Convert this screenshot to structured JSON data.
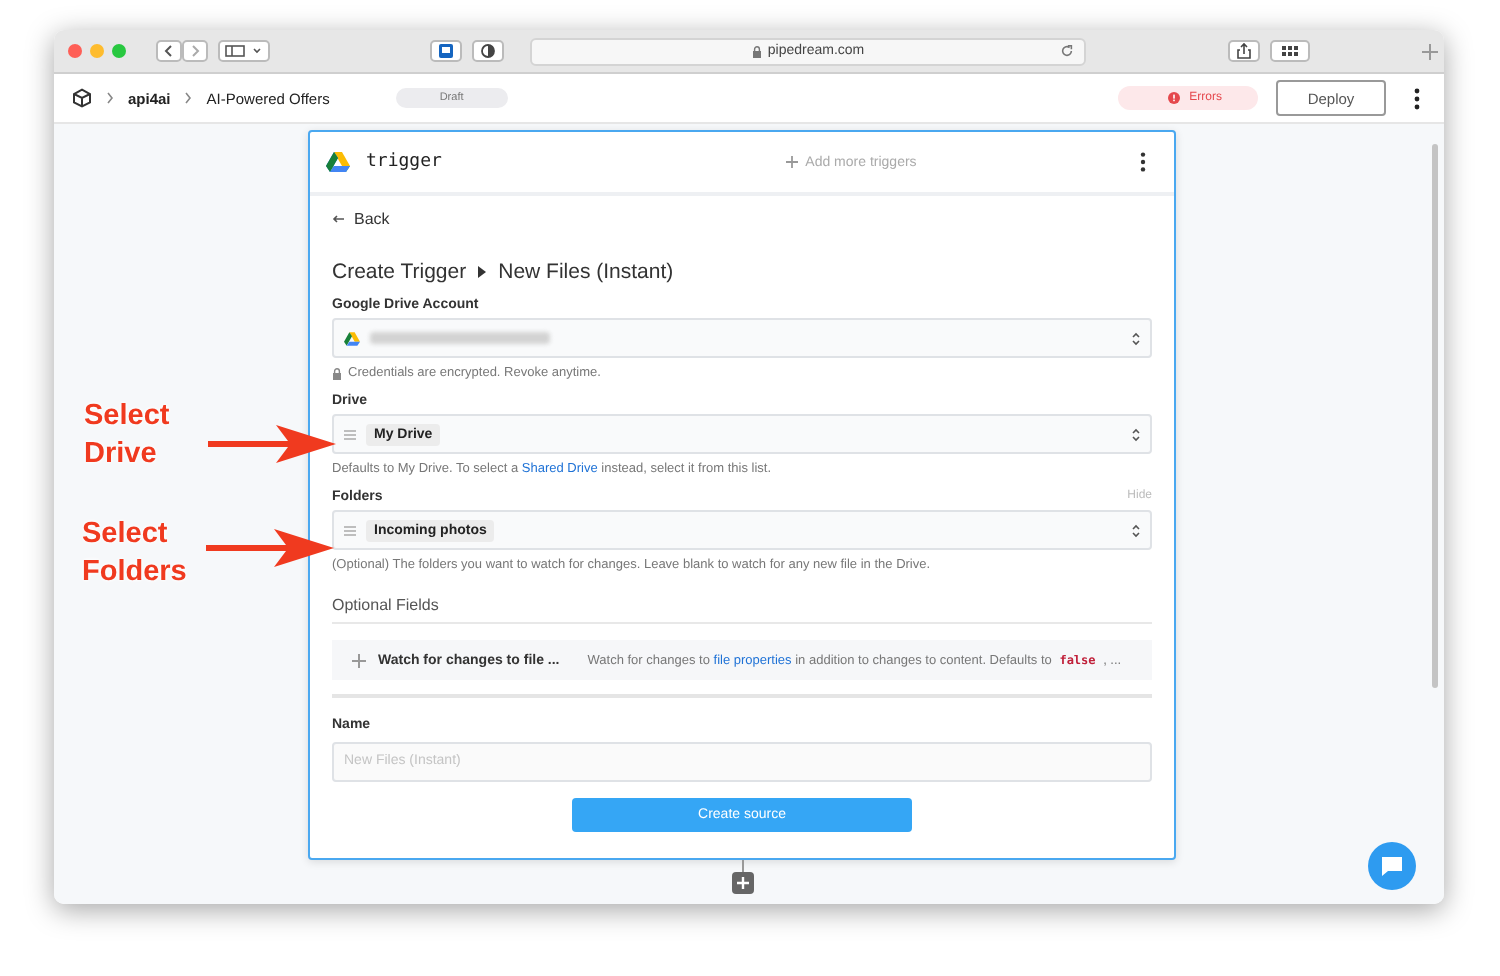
{
  "browser": {
    "url": "pipedream.com"
  },
  "header": {
    "breadcrumbs": [
      "api4ai",
      "AI-Powered Offers"
    ],
    "status_badge": "Draft",
    "errors_button": "Errors",
    "deploy_button": "Deploy"
  },
  "panel": {
    "app_name": "trigger",
    "add_triggers": "Add more triggers",
    "back": "Back",
    "title": "Create Trigger",
    "subtitle": "New Files (Instant)",
    "fields": [
      {
        "kind": "account",
        "label": "Google Drive Account",
        "note": [
          {
            "kind": "text",
            "text": "Credentials are encrypted. Revoke anytime."
          }
        ]
      },
      {
        "kind": "select",
        "label": "Drive",
        "value": "My Drive",
        "note": [
          {
            "kind": "text",
            "text": "Defaults to My Drive. To select a "
          },
          {
            "kind": "link",
            "text": "Shared Drive"
          },
          {
            "kind": "text",
            "text": " instead, select it from this list."
          }
        ]
      },
      {
        "kind": "select",
        "label": "Folders",
        "hide": "Hide",
        "value": "Incoming photos",
        "note": [
          {
            "kind": "text",
            "text": "(Optional) The folders you want to watch for changes. Leave blank to watch for any new file in the Drive."
          }
        ]
      }
    ],
    "optional": {
      "heading": "Optional Fields",
      "items": [
        {
          "label": "Watch for changes to file ...",
          "description": [
            {
              "kind": "text",
              "text": "Watch for changes to "
            },
            {
              "kind": "link",
              "text": "file properties"
            },
            {
              "kind": "text",
              "text": " in addition to changes to content. Defaults to "
            },
            {
              "kind": "code",
              "text": "false"
            },
            {
              "kind": "text",
              "text": " , ..."
            }
          ]
        }
      ]
    },
    "name_field": {
      "label": "Name",
      "placeholder": "New Files (Instant)"
    },
    "submit": "Create source"
  },
  "callouts": [
    "Select Drive",
    "Select Folders"
  ]
}
